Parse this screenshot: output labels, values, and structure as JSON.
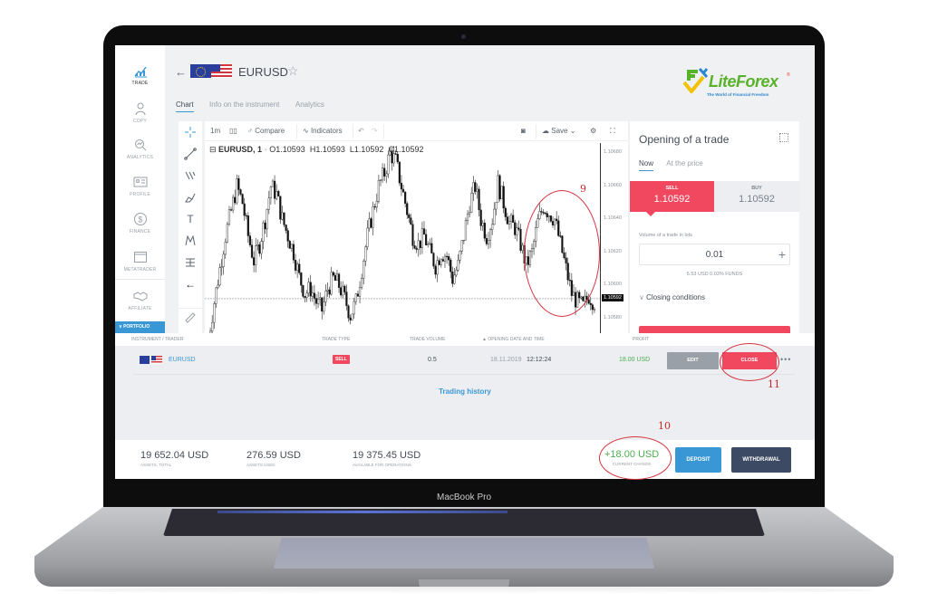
{
  "device": {
    "label": "MacBook Pro"
  },
  "nav": {
    "items": [
      {
        "label": "TRADE",
        "icon": "chart-trend-icon",
        "active": true
      },
      {
        "label": "COPY",
        "icon": "trader-person-icon",
        "active": false
      },
      {
        "label": "ANALYTICS",
        "icon": "analytics-magnifier-icon",
        "active": false
      },
      {
        "label": "PROFILE",
        "icon": "id-card-icon",
        "active": false
      },
      {
        "label": "FINANCE",
        "icon": "dollar-coin-icon",
        "active": false
      },
      {
        "label": "METATRADER",
        "icon": "window-icon",
        "active": false
      },
      {
        "label": "AFFILIATE",
        "icon": "handshake-icon",
        "active": false
      }
    ],
    "portfolio_label": "PORTFOLIO"
  },
  "header": {
    "back_icon": "arrow-left-icon",
    "symbol": "EURUSD",
    "favorite_icon": "star-outline-icon",
    "tabs": [
      {
        "label": "Chart",
        "active": true
      },
      {
        "label": "Info on the instrument",
        "active": false
      },
      {
        "label": "Analytics",
        "active": false
      }
    ]
  },
  "brand": {
    "name_lite": "Lite",
    "name_forex": "Forex",
    "registered": "®",
    "tagline": "The World of Financial Freedom",
    "colors": {
      "green": "#58b22c",
      "yellow": "#f2c200",
      "blue": "#2c86d0"
    }
  },
  "chart_toolbar": {
    "interval": "1m",
    "compare_label": "Compare",
    "indicators_label": "Indicators",
    "save_label": "Save"
  },
  "drawing_tools": [
    "crosshair-icon",
    "trend-line-icon",
    "fib-tool-icon",
    "brush-icon",
    "text-tool-icon",
    "pattern-icon",
    "measure-icon",
    "arrow-back-icon",
    "ruler-icon"
  ],
  "chart": {
    "legend": {
      "symbol": "EURUSD, 1",
      "open": "O1.10593",
      "high": "H1.10593",
      "low": "L1.10592",
      "close": "C1.10592"
    },
    "last_price": "1.10592"
  },
  "chart_data": {
    "type": "candlestick",
    "title": "EURUSD, 1",
    "xlabel": "",
    "ylabel": "",
    "ylim": [
      1.1057,
      1.10685
    ],
    "price_ticks": [
      "1.10680",
      "1.10660",
      "1.10640",
      "1.10620",
      "1.10600",
      "1.10580"
    ],
    "reference_line": 1.10592,
    "approx_close_path": [
      1.10568,
      1.1059,
      1.1061,
      1.1063,
      1.10645,
      1.1066,
      1.1065,
      1.1063,
      1.10615,
      1.10625,
      1.1064,
      1.1066,
      1.10655,
      1.1064,
      1.1063,
      1.1062,
      1.10605,
      1.10595,
      1.10598,
      1.1059,
      1.10585,
      1.10598,
      1.10604,
      1.106,
      1.10592,
      1.10582,
      1.1059,
      1.1061,
      1.1063,
      1.10645,
      1.1066,
      1.10668,
      1.1068,
      1.10675,
      1.1066,
      1.10645,
      1.1063,
      1.10625,
      1.1063,
      1.1062,
      1.10612,
      1.1062,
      1.10618,
      1.10604,
      1.10612,
      1.1063,
      1.1065,
      1.1066,
      1.1064,
      1.1063,
      1.1064,
      1.10662,
      1.1065,
      1.10638,
      1.10635,
      1.10625,
      1.10612,
      1.1062,
      1.10638,
      1.10648,
      1.10644,
      1.1064,
      1.10625,
      1.1061,
      1.10595,
      1.1059,
      1.10587,
      1.10594,
      1.1059
    ]
  },
  "trade_panel": {
    "title": "Opening of a trade",
    "tabs": [
      {
        "label": "Now",
        "active": true
      },
      {
        "label": "At the price",
        "active": false
      }
    ],
    "sell": {
      "label": "SELL",
      "price": "1.10592"
    },
    "buy": {
      "label": "BUY",
      "price": "1.10592"
    },
    "volume_label": "Volume of a trade in lots",
    "volume_value": "0.01",
    "volume_info": "5.53 USD  0.03% FUNDS",
    "closing_conditions": "Closing conditions"
  },
  "positions": {
    "columns": [
      "INSTRUMENT / TRADER",
      "TRADE TYPE",
      "TRADE VOLUME",
      "▲ OPENING DATE AND TIME",
      "PROFIT"
    ],
    "rows": [
      {
        "instrument": "EURUSD",
        "type": "SELL",
        "volume": "0.5",
        "date": "18.11.2019",
        "time": "12:12:24",
        "profit": "18.00 USD"
      }
    ],
    "edit_label": "EDIT",
    "close_label": "CLOSE",
    "more_label": "•••",
    "history_link": "Trading history"
  },
  "footer": {
    "assets_total": {
      "value": "19 652.04 USD",
      "label": "ASSETS, TOTAL"
    },
    "assets_used": {
      "value": "276.59 USD",
      "label": "ASSETS USED"
    },
    "available": {
      "value": "19 375.45 USD",
      "label": "AVAILABLE FOR OPERATIONS"
    },
    "current_change": {
      "value": "+18.00 USD",
      "label": "CURRENT CHANGE"
    },
    "deposit_label": "DEPOSIT",
    "withdrawal_label": "WITHDRAWAL"
  },
  "annotations": [
    {
      "number": "9",
      "target": "chart-recent-drop"
    },
    {
      "number": "10",
      "target": "current-change"
    },
    {
      "number": "11",
      "target": "close-button"
    }
  ],
  "colors": {
    "accent_blue": "#3a97d6",
    "sell_red": "#f2485f",
    "profit_green": "#4caf50",
    "dark_button": "#3d4a63"
  }
}
